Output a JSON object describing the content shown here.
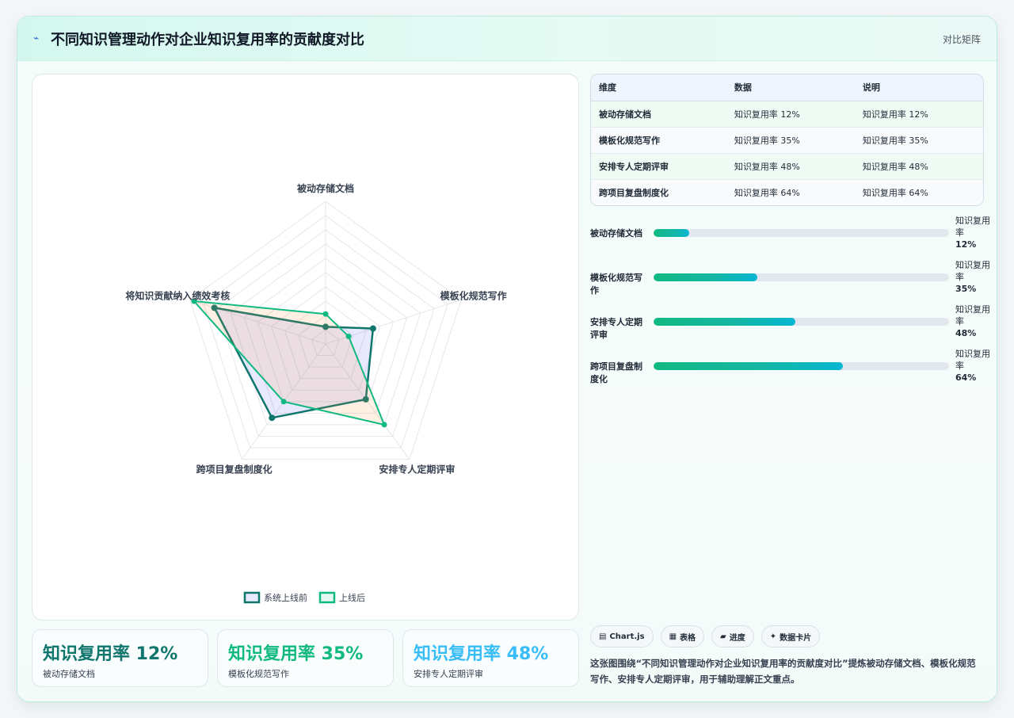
{
  "header": {
    "icon": "⌁",
    "title": "不同知识管理动作对企业知识复用率的贡献度对比",
    "badge": "对比矩阵"
  },
  "chart_data": {
    "type": "radar",
    "axes": [
      "被动存储文档",
      "模板化规范写作",
      "安排专人定期评审",
      "跨项目复盘制度化",
      "将知识贡献纳入绩效考核"
    ],
    "r_range": [
      0,
      100
    ],
    "series": [
      {
        "name": "系统上线前",
        "values": [
          12,
          35,
          48,
          64,
          82
        ],
        "color": "#0f766e"
      },
      {
        "name": "上线后",
        "values": [
          21,
          17,
          70,
          50,
          97
        ],
        "color": "#10b981"
      }
    ],
    "legend_position": "bottom"
  },
  "table": {
    "headers": [
      "维度",
      "数据",
      "说明"
    ],
    "rows": [
      [
        "被动存储文档",
        "知识复用率 12%",
        "知识复用率 12%"
      ],
      [
        "模板化规范写作",
        "知识复用率 35%",
        "知识复用率 35%"
      ],
      [
        "安排专人定期评审",
        "知识复用率 48%",
        "知识复用率 48%"
      ],
      [
        "跨项目复盘制度化",
        "知识复用率 64%",
        "知识复用率 64%"
      ]
    ]
  },
  "progress": [
    {
      "label": "被动存储文档",
      "value_text": "知识复用率",
      "value_pct": "12%",
      "pct": 12
    },
    {
      "label": "模板化规范写作",
      "value_text": "知识复用率",
      "value_pct": "35%",
      "pct": 35
    },
    {
      "label": "安排专人定期评审",
      "value_text": "知识复用率",
      "value_pct": "48%",
      "pct": 48
    },
    {
      "label": "跨项目复盘制度化",
      "value_text": "知识复用率",
      "value_pct": "64%",
      "pct": 64
    }
  ],
  "kpis": [
    {
      "value": "知识复用率 12%",
      "label": "被动存储文档",
      "color": "#0f766e"
    },
    {
      "value": "知识复用率 35%",
      "label": "模板化规范写作",
      "color": "#10b981"
    },
    {
      "value": "知识复用率 48%",
      "label": "安排专人定期评审",
      "color": "#38bdf8"
    }
  ],
  "tags": [
    {
      "icon": "▤",
      "label": "Chart.js"
    },
    {
      "icon": "▦",
      "label": "表格"
    },
    {
      "icon": "▰",
      "label": "进度"
    },
    {
      "icon": "✦",
      "label": "数据卡片"
    }
  ],
  "description": "这张图围绕“不同知识管理动作对企业知识复用率的贡献度对比”提炼被动存储文档、模板化规范写作、安排专人定期评审，用于辅助理解正文重点。"
}
